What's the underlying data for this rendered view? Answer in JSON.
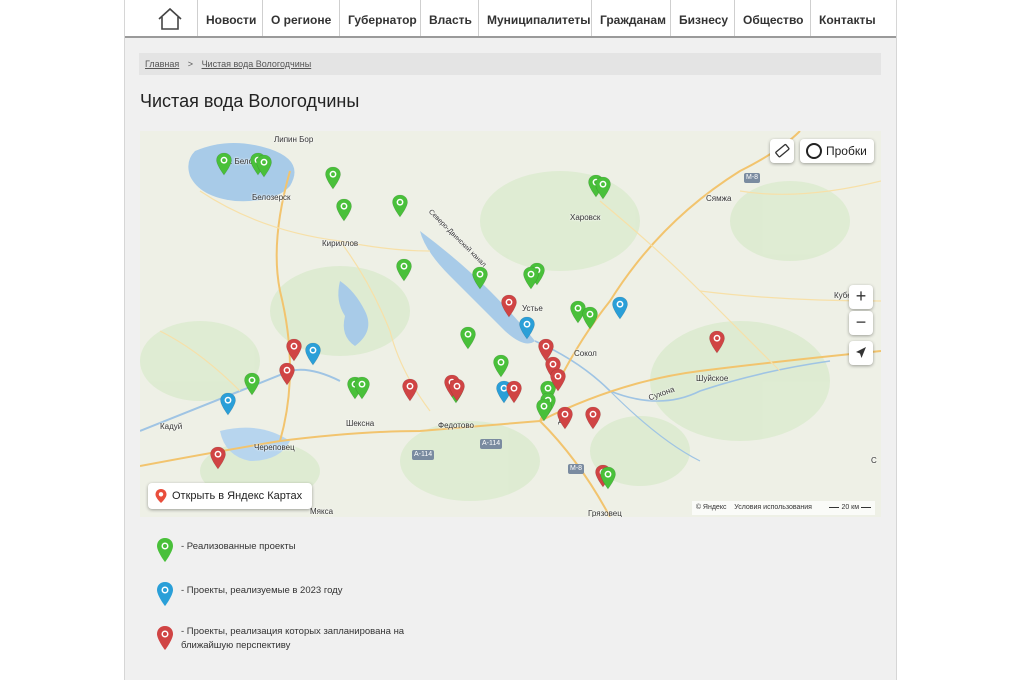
{
  "nav": {
    "items": [
      "Новости",
      "О регионе",
      "Губернатор",
      "Власть",
      "Муниципалитеты",
      "Гражданам",
      "Бизнесу",
      "Общество",
      "Контакты"
    ]
  },
  "breadcrumb": {
    "home": "Главная",
    "separator": ">",
    "current": "Чистая вода Вологодчины"
  },
  "page_title": "Чистая вода Вологодчины",
  "map": {
    "traffic_label": "Пробки",
    "zoom_in": "+",
    "zoom_out": "−",
    "open_in_yandex": "Открыть в Яндекс Картах",
    "copyright": "© Яндекс",
    "terms": "Условия использования",
    "scale": "20 км",
    "places": {
      "lake": "оз. Белое",
      "belozersk": "Белозерск",
      "kirillov": "Кириллов",
      "kharovsk": "Харовск",
      "syamzha": "Сямжа",
      "ustye": "Устье",
      "sokol": "Сокол",
      "shuyskoe": "Шуйское",
      "kaduy": "Кадуй",
      "cherepovets": "Череповец",
      "sheksna": "Шексна",
      "fedotovo": "Федотово",
      "vologda": "да",
      "myaksa": "Мякса",
      "gryazovets": "Грязовец",
      "lipin_bor": "Липин Бор",
      "kubenskoe": "Кубенск",
      "canal": "Северо-Двинский канал",
      "sukhona": "Сухона",
      "edge_c": "С"
    },
    "roads": [
      "М-8",
      "А-114",
      "А-114",
      "М-8"
    ],
    "colors": {
      "green": "#49c03a",
      "blue": "#2a9fd8",
      "red": "#d04444"
    }
  },
  "legend": [
    {
      "color": "green",
      "text": "- Реализованные проекты"
    },
    {
      "color": "blue",
      "text": "- Проекты, реализуемые в 2023 году"
    },
    {
      "color": "red",
      "text": "- Проекты, реализация которых запланирована на ближайшую перспективу"
    }
  ]
}
